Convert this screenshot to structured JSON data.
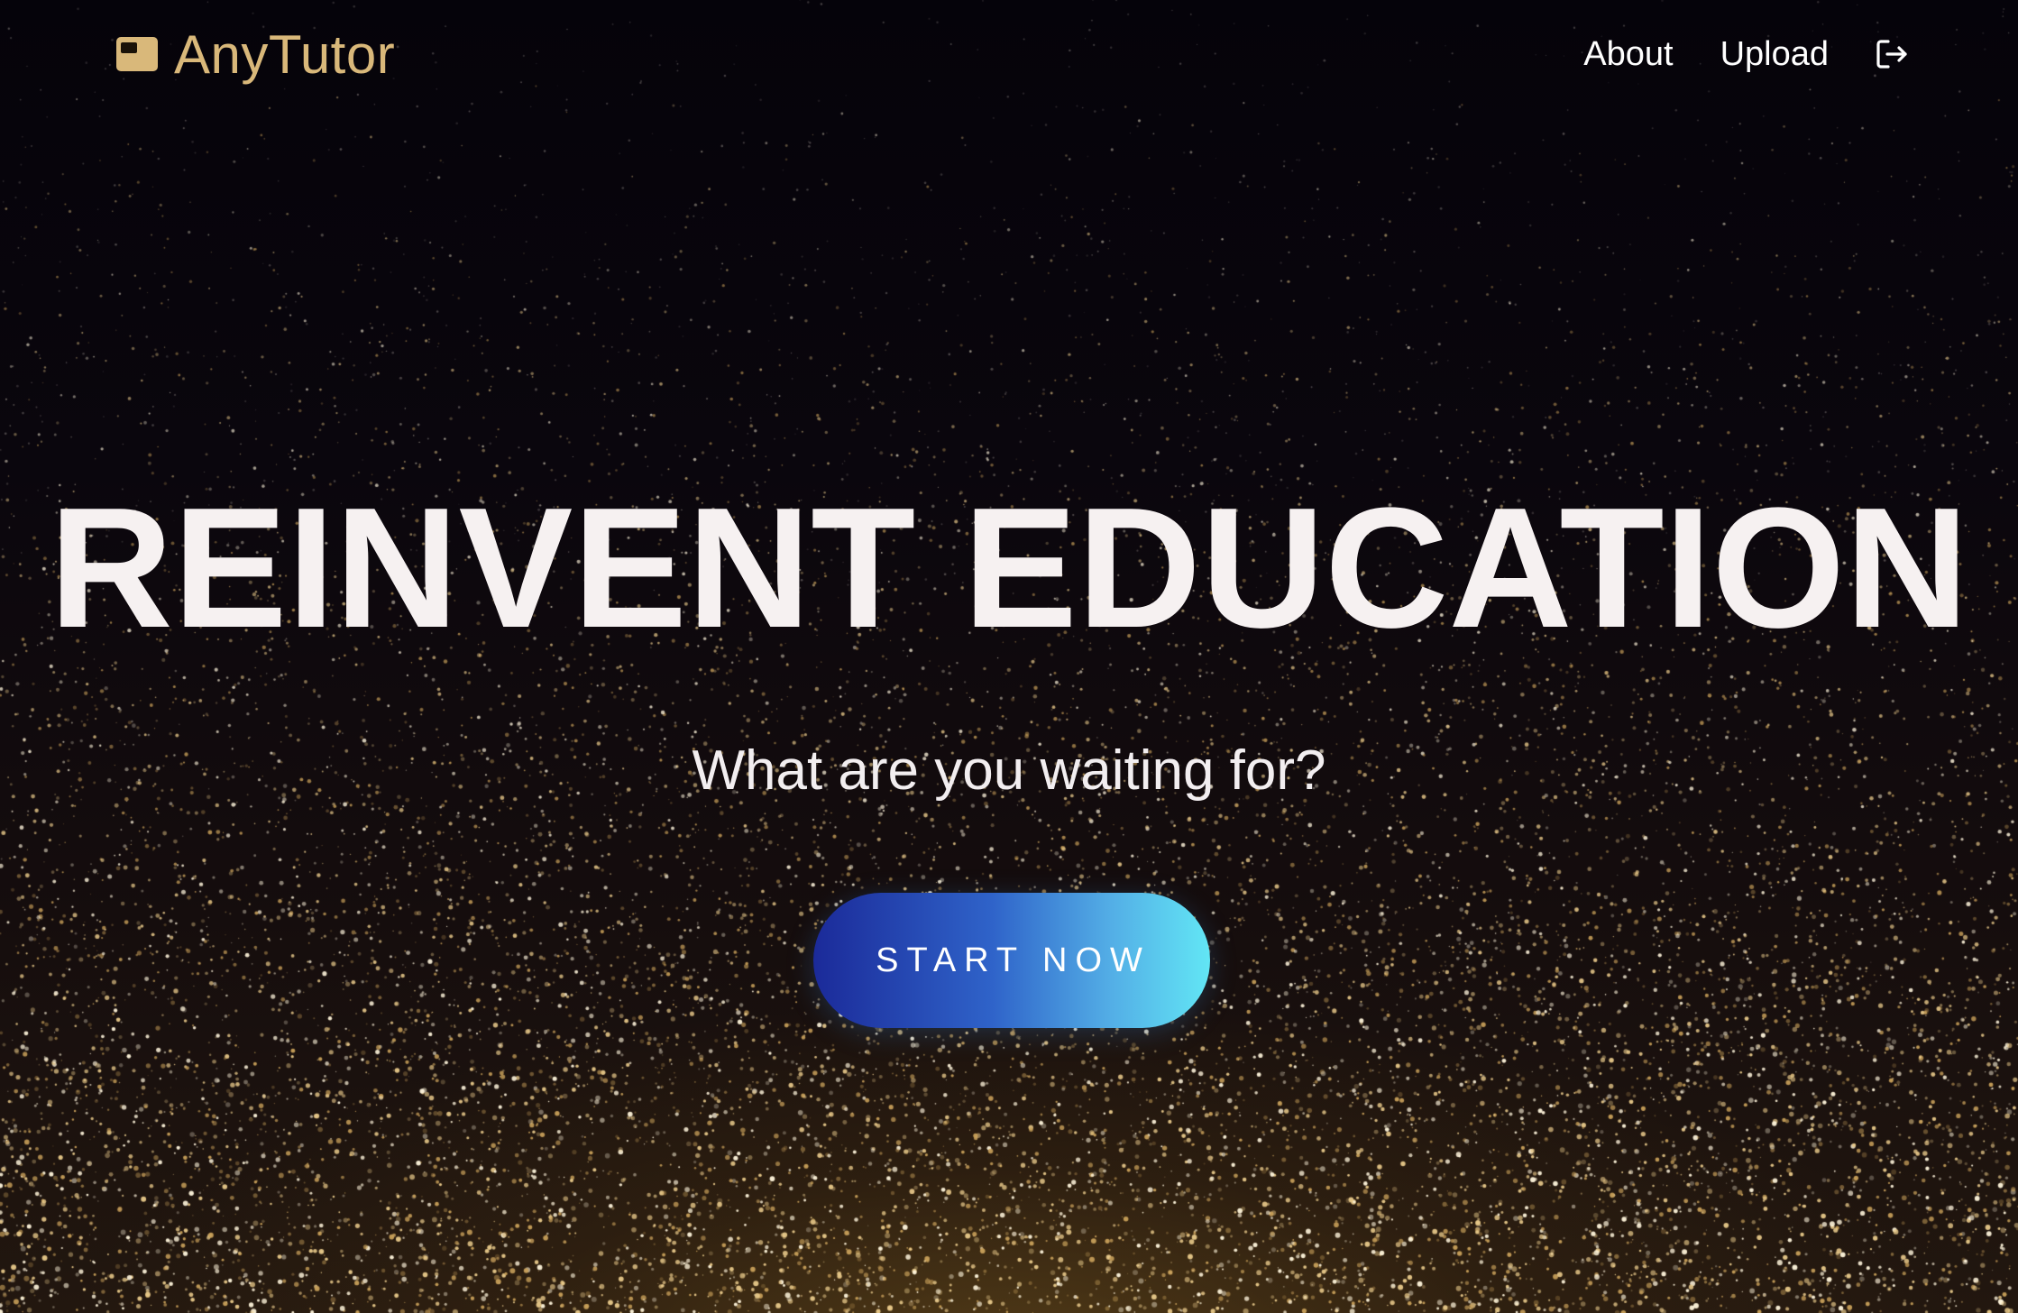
{
  "header": {
    "brand_name": "AnyTutor",
    "brand_icon": "window-icon",
    "nav": [
      {
        "label": "About"
      },
      {
        "label": "Upload"
      }
    ],
    "logout_icon": "logout-icon"
  },
  "hero": {
    "headline": "REINVENT EDUCATION",
    "subtitle": "What are you waiting for?",
    "cta_label": "START NOW"
  },
  "colors": {
    "brand": "#d9b87a",
    "background": "#07050b",
    "headline": "#f6f1f1",
    "cta_gradient_start": "#1b2a99",
    "cta_gradient_end": "#62e6f5",
    "particles": "#e8c98a"
  }
}
